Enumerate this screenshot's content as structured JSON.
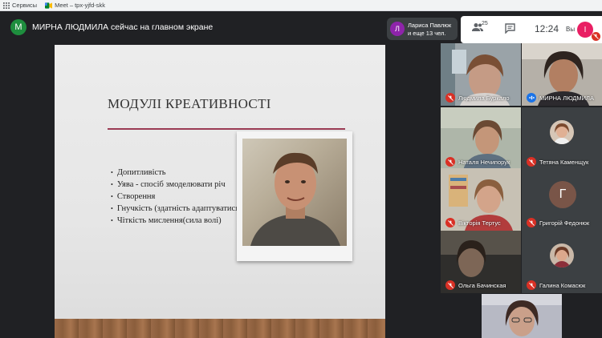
{
  "bookmarks": [
    {
      "label": "Сервисы",
      "icon": "apps-grid-icon"
    },
    {
      "label": "Meet – tpx-yjfd-skk",
      "icon": "meet-icon"
    }
  ],
  "topbar": {
    "presenter_initial": "M",
    "presenter_text": "МИРНА ЛЮДМИЛА сейчас на главном экране",
    "raised": {
      "initial": "Л",
      "line1": "Лариса Павлюк",
      "line2": "и еще 13 чел."
    },
    "people_count": "25",
    "time": "12:24",
    "you_label": "Вы",
    "self_initial": "I"
  },
  "slide": {
    "title": "МОДУЛІ КРЕАТИВНОСТІ",
    "bullets": [
      "Допитливість",
      "Уява - спосіб змоделювати річ",
      "Створення",
      "Гнучкість (здатність адаптуватися",
      "Чіткість мислення(сила волі)"
    ]
  },
  "participants": [
    {
      "name": "Людмила Буркало",
      "status": "muted",
      "kind": "camera"
    },
    {
      "name": "МИРНА ЛЮДМИЛА",
      "status": "speaking",
      "kind": "camera"
    },
    {
      "name": "Наталя Нечипорук",
      "status": "muted",
      "kind": "camera"
    },
    {
      "name": "Тетяна Каменщук",
      "status": "muted",
      "kind": "photo"
    },
    {
      "name": "Вікторія Тертус",
      "status": "muted",
      "kind": "camera"
    },
    {
      "name": "Григорій Федонюк",
      "status": "muted",
      "kind": "letter",
      "initial": "Г"
    },
    {
      "name": "Ольга Бачинская",
      "status": "muted",
      "kind": "camera"
    },
    {
      "name": "Галина Комасюк",
      "status": "muted",
      "kind": "photo"
    },
    {
      "name": "",
      "status": "none",
      "kind": "camera"
    }
  ],
  "colors": {
    "meet_dark": "#202124",
    "tile_bg": "#3c4043",
    "mute_red": "#d93025",
    "slide_rule": "#9b3b54"
  }
}
